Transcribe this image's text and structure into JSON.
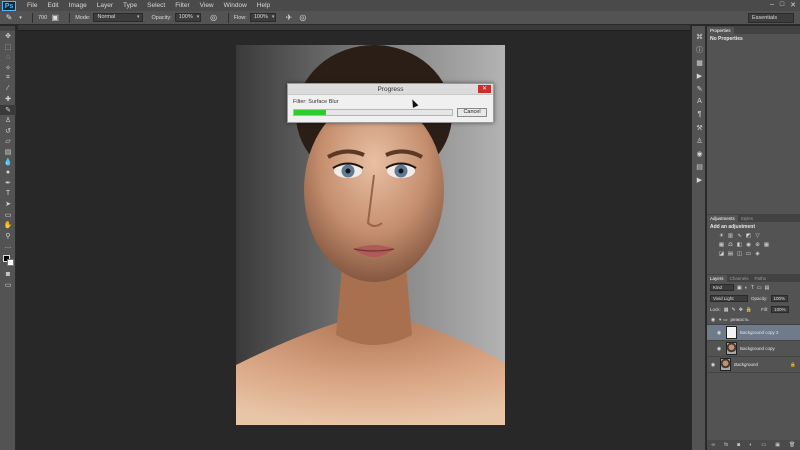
{
  "app": {
    "logo": "Ps"
  },
  "menu": [
    "File",
    "Edit",
    "Image",
    "Layer",
    "Type",
    "Select",
    "Filter",
    "View",
    "Window",
    "Help"
  ],
  "window_controls": [
    "–",
    "□",
    "✕"
  ],
  "options_bar": {
    "size_value": "700",
    "mode_label": "Mode:",
    "mode_value": "Normal",
    "opacity_label": "Opacity:",
    "opacity_value": "100%",
    "flow_label": "Flow:",
    "flow_value": "100%",
    "workspace": "Essentials"
  },
  "progress_dialog": {
    "title": "Progress",
    "close": "✕",
    "filter_text": "Filter: Surface Blur",
    "progress_fraction": 0.2,
    "progress_color": "#2ecc2e",
    "cancel_label": "Cancel"
  },
  "properties_panel": {
    "tabs": [
      "Properties"
    ],
    "empty_text": "No Properties"
  },
  "adjustments_panel": {
    "tabs": [
      "Adjustments",
      "Styles"
    ],
    "title": "Add an adjustment"
  },
  "layers_panel": {
    "tabs": [
      "Layers",
      "Channels",
      "Paths"
    ],
    "kind_filter": "Kind",
    "blend_mode": "Vivid Light",
    "opacity_label": "Opacity:",
    "opacity_value": "100%",
    "lock_label": "Lock:",
    "fill_label": "Fill:",
    "fill_value": "100%",
    "group_name": "резкость",
    "layers": [
      {
        "name": "Background copy 2",
        "thumb": "white",
        "selected": true
      },
      {
        "name": "Background copy",
        "thumb": "face",
        "selected": false
      },
      {
        "name": "Background",
        "thumb": "face",
        "selected": false
      }
    ]
  },
  "colors": {
    "ui_dark": "#535353",
    "canvas_bg": "#282828",
    "selected_layer": "#6f7a8a"
  }
}
